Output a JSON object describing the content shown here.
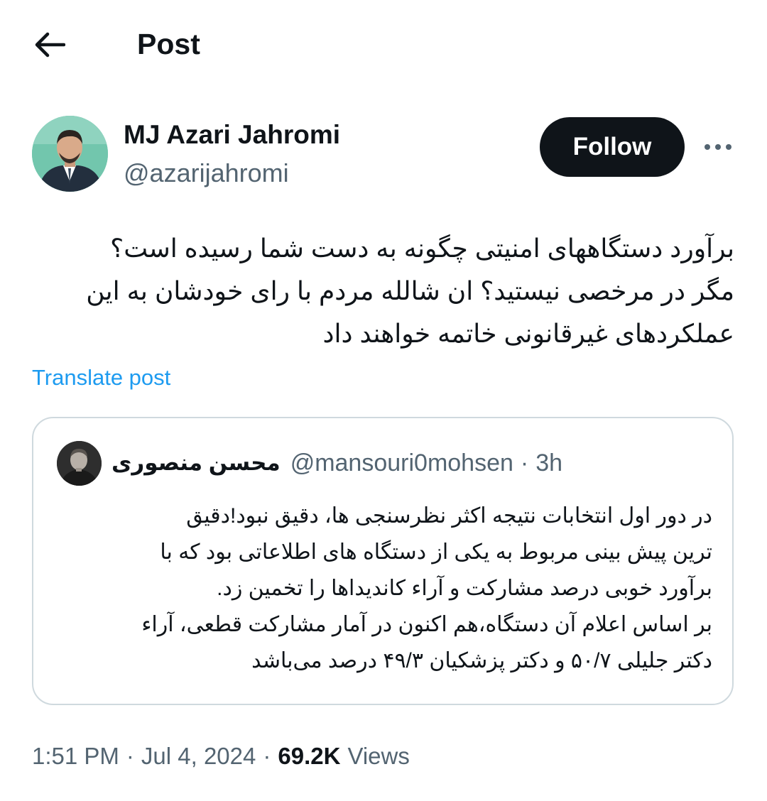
{
  "header": {
    "title": "Post"
  },
  "author": {
    "display_name": "MJ Azari Jahromi",
    "handle": "@azarijahromi",
    "follow_label": "Follow"
  },
  "post": {
    "lines": [
      "برآورد دستگاههای امنیتی چگونه به دست شما رسیده است؟",
      "مگر در مرخصی نیستید؟ ان شالله مردم با رای خودشان به این",
      "عملکردهای غیرقانونی خاتمه خواهند داد"
    ],
    "translate_label": "Translate post"
  },
  "quote": {
    "name": "محسن منصوری",
    "handle": "@mansouri0mohsen",
    "dot": "·",
    "time": "3h",
    "lines": [
      "در دور اول انتخابات نتیجه اکثر نظرسنجی ها، دقیق نبود!دقیق",
      "ترین پیش بینی مربوط به یکی از دستگاه های اطلاعاتی بود که با",
      "برآورد خوبی درصد مشارکت و آراء کاندیداها را تخمین زد.",
      "بر اساس اعلام آن دستگاه،هم اکنون در آمار مشارکت قطعی، آراء",
      "دکتر جلیلی ۵۰/۷ و دکتر پزشکیان ۴۹/۳ درصد می‌باشد"
    ]
  },
  "meta": {
    "time": "1:51 PM",
    "sep": "·",
    "date": "Jul 4, 2024",
    "views_count": "69.2K",
    "views_label": "Views"
  },
  "icons": {
    "back": "arrow-left-icon",
    "more": "more-horizontal-icon"
  },
  "colors": {
    "text": "#0f1419",
    "secondary": "#536471",
    "link": "#1d9bf0",
    "button": "#0f1419",
    "border": "#cfd9de"
  }
}
